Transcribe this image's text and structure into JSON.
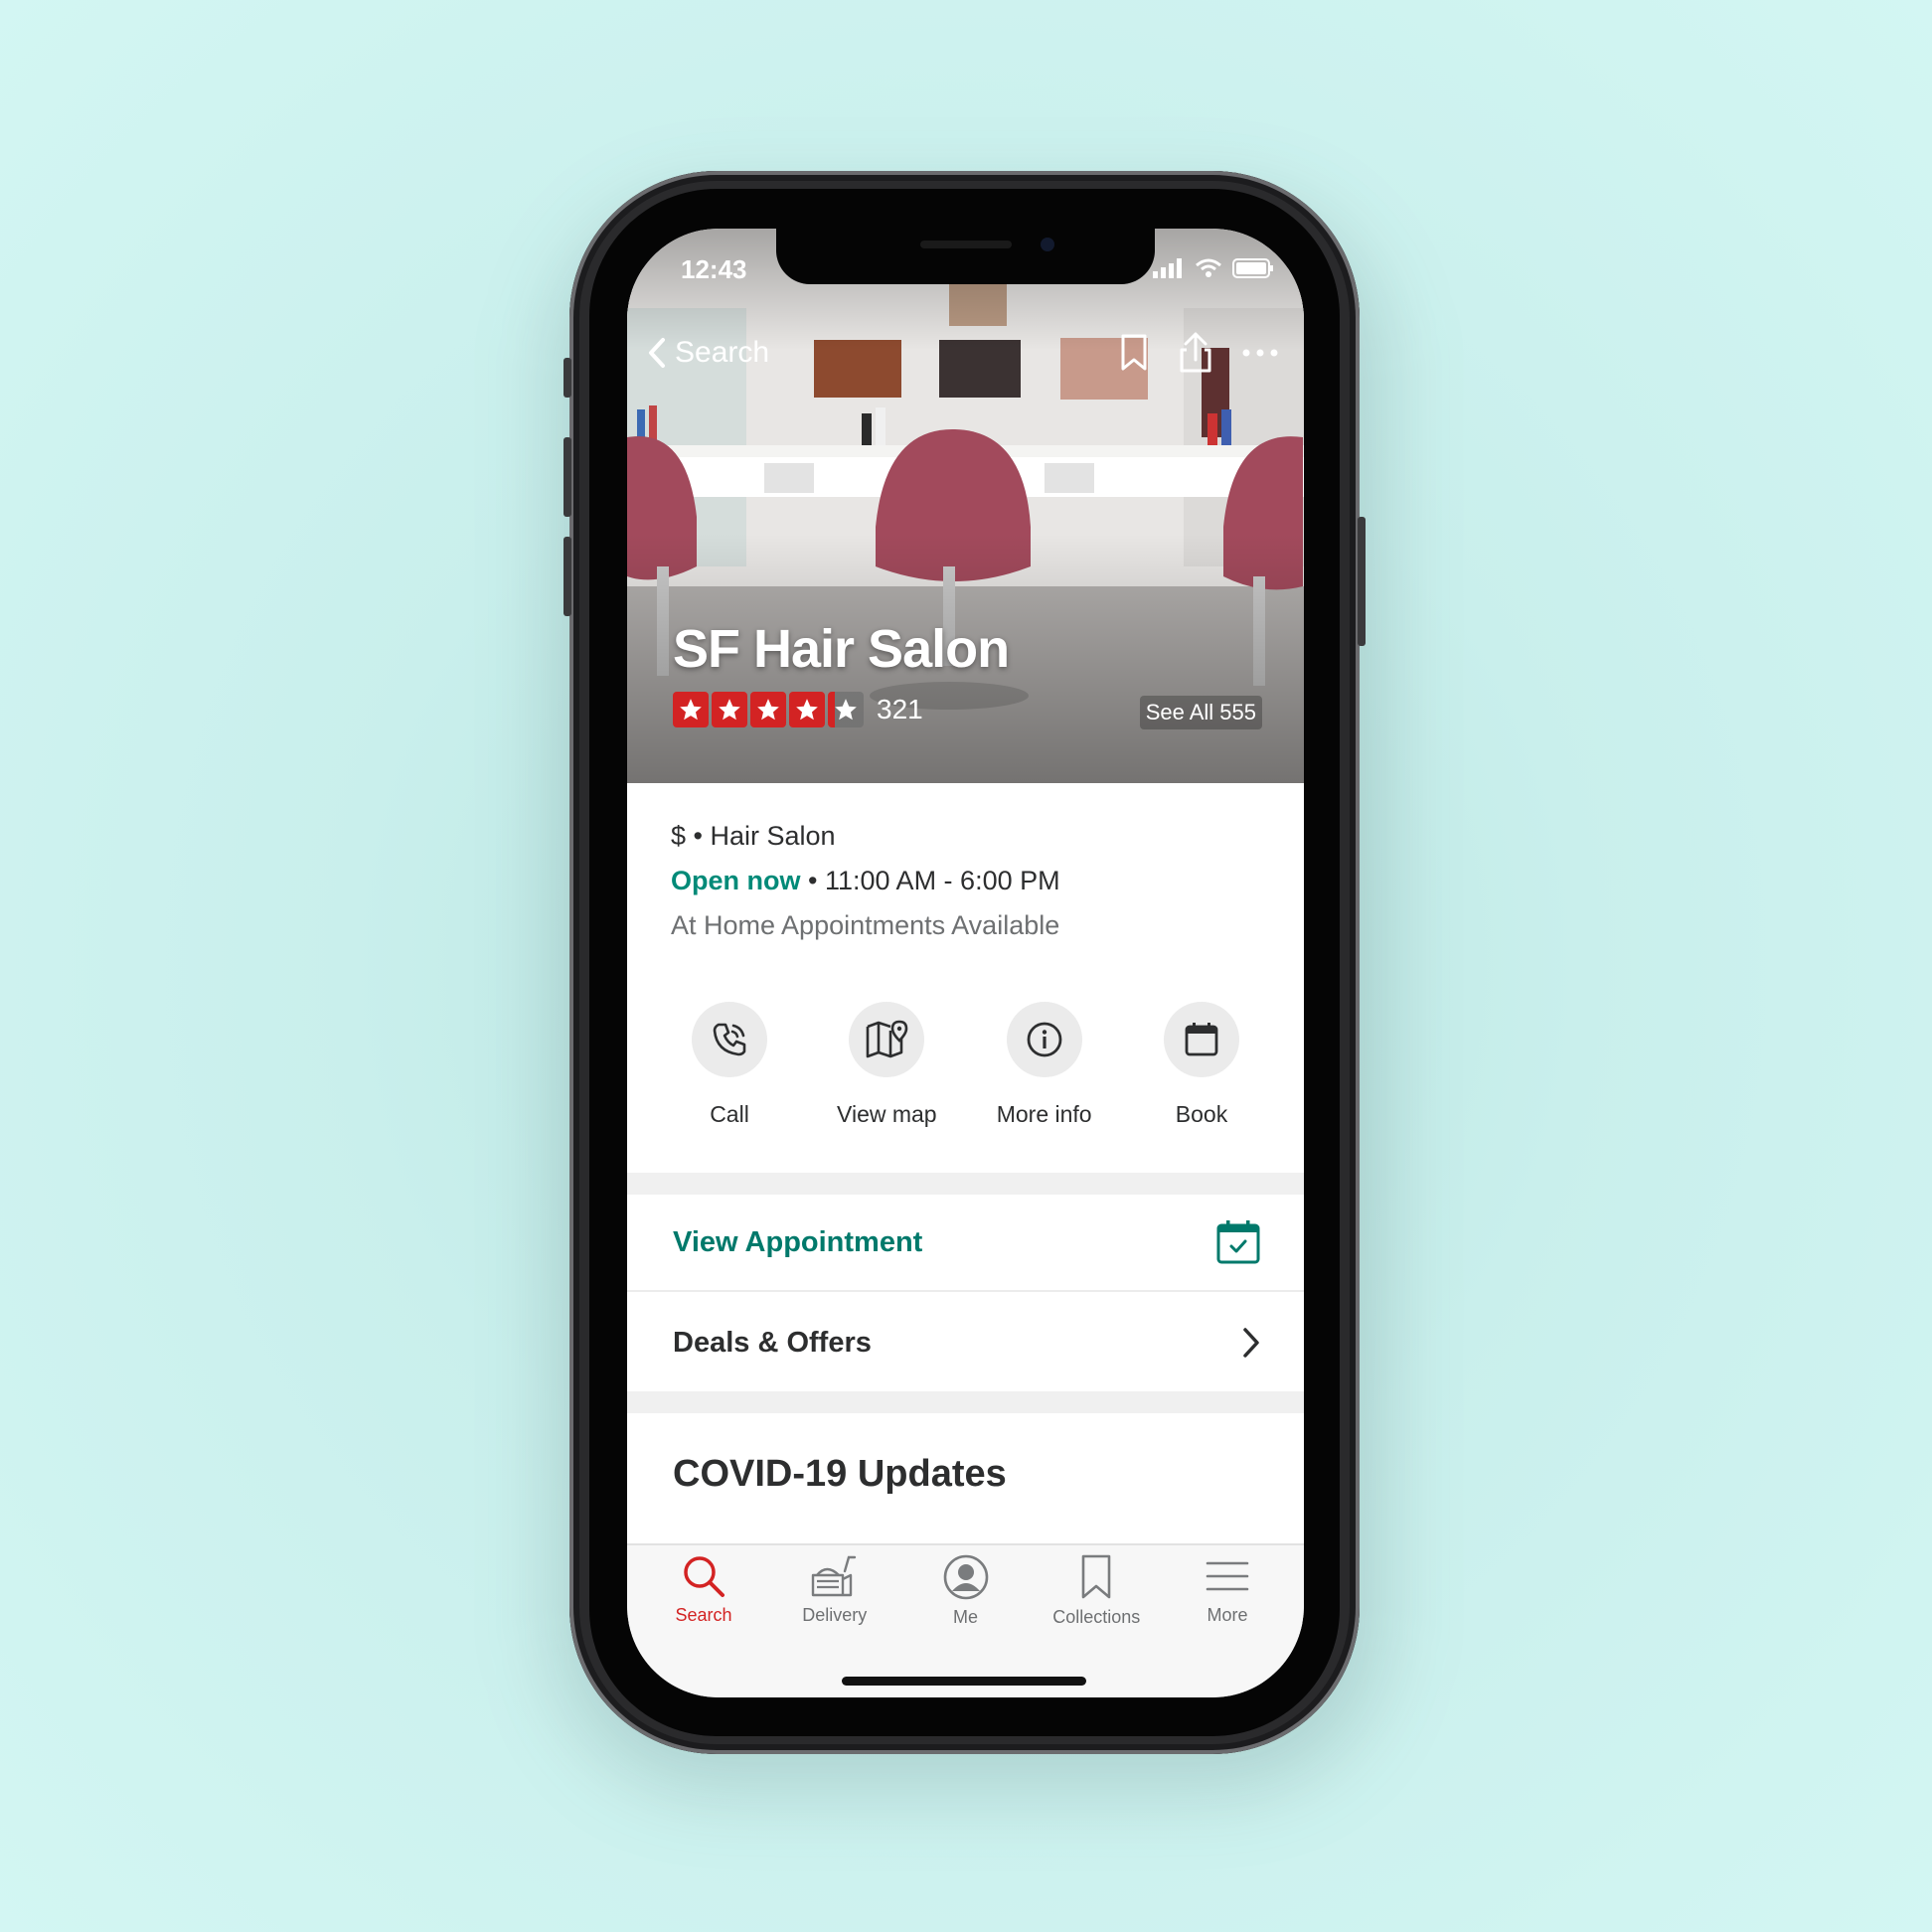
{
  "status_bar": {
    "time": "12:43"
  },
  "nav": {
    "back_label": "Search"
  },
  "business": {
    "name": "SF Hair Salon",
    "rating_stars": 4.5,
    "review_count": "321",
    "see_all": "See All 555",
    "price": "$",
    "separator": "•",
    "category": "Hair Salon",
    "open_status": "Open now",
    "hours": "11:00 AM - 6:00 PM",
    "note": "At Home Appointments Available"
  },
  "actions": [
    {
      "label": "Call",
      "icon": "phone-icon"
    },
    {
      "label": "View map",
      "icon": "map-icon"
    },
    {
      "label": "More info",
      "icon": "info-icon"
    },
    {
      "label": "Book",
      "icon": "calendar-icon"
    }
  ],
  "rows": {
    "appointment": "View Appointment",
    "deals": "Deals & Offers"
  },
  "section_title": "COVID-19 Updates",
  "tabbar": [
    {
      "label": "Search",
      "icon": "search-icon",
      "active": true
    },
    {
      "label": "Delivery",
      "icon": "delivery-icon",
      "active": false
    },
    {
      "label": "Me",
      "icon": "profile-icon",
      "active": false
    },
    {
      "label": "Collections",
      "icon": "bookmark-icon",
      "active": false
    },
    {
      "label": "More",
      "icon": "menu-icon",
      "active": false
    }
  ],
  "colors": {
    "brand_red": "#d32323",
    "teal": "#008a78",
    "background": "#c9efec"
  }
}
